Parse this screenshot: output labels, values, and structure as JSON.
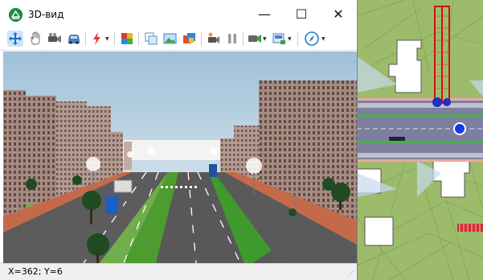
{
  "window": {
    "title": "3D-вид"
  },
  "titlebar": {
    "minimize": "—",
    "maximize": "☐",
    "close": "✕"
  },
  "toolbar": {
    "tools": [
      {
        "name": "move-view-tool",
        "icon": "move-arrows-icon"
      },
      {
        "name": "pan-hand-tool",
        "icon": "hand-icon"
      },
      {
        "name": "camera-tool",
        "icon": "video-camera-icon"
      },
      {
        "name": "vehicle-tool",
        "icon": "car-icon"
      },
      {
        "name": "effects-tool",
        "icon": "lightning-icon",
        "dropdown": true
      },
      {
        "name": "palette-tool",
        "icon": "palette-icon"
      },
      {
        "name": "copy-tool",
        "icon": "copy-window-icon"
      },
      {
        "name": "picture-tool",
        "icon": "picture-icon"
      },
      {
        "name": "layers-tool",
        "icon": "layers-icon"
      },
      {
        "name": "record-camera-tool",
        "icon": "record-camera-icon"
      },
      {
        "name": "pause-tool",
        "icon": "pause-icon"
      },
      {
        "name": "render-tool",
        "icon": "render-icon",
        "dropdown": true
      },
      {
        "name": "export-tool",
        "icon": "export-icon",
        "dropdown": true
      },
      {
        "name": "navigate-tool",
        "icon": "compass-icon",
        "dropdown": true
      }
    ],
    "dropdown_glyph": "▼"
  },
  "status": {
    "coords": "X=362; Y=6"
  },
  "colors": {
    "accent": "#1e8a4c",
    "sky": "#dce8f0",
    "grass": "#5fb03e",
    "asphalt": "#5c5c5c",
    "building": "#a4857a"
  }
}
